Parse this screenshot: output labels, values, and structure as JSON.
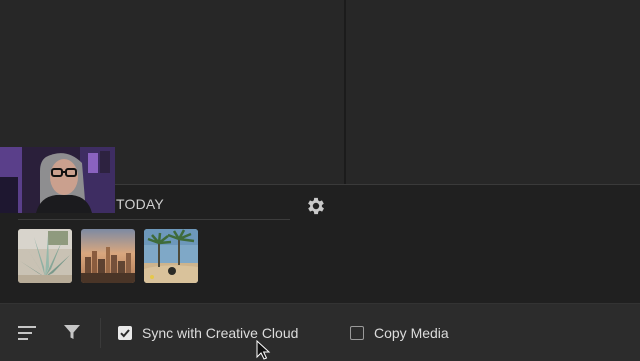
{
  "import_panel": {
    "section_title": "TODAY",
    "settings_icon": "gear-icon",
    "thumbnails": [
      {
        "name": "agave-plant-photo",
        "alt": "Agave plant"
      },
      {
        "name": "city-skyline-photo",
        "alt": "City skyline at dusk"
      },
      {
        "name": "desert-palm-photo",
        "alt": "Desert palm trees"
      }
    ]
  },
  "bottom_bar": {
    "sort_icon": "sort-lines-icon",
    "filter_icon": "filter-funnel-icon",
    "sync_label": "Sync with Creative Cloud",
    "sync_checked": true,
    "copy_label": "Copy Media",
    "copy_checked": false
  },
  "overlay": {
    "webcam": "presenter-webcam"
  },
  "colors": {
    "background": "#262626",
    "panel": "#202020",
    "bottom_bar": "#2c2c2c",
    "text": "#dcdcdc",
    "checkbox_on": "#e9e9e9"
  }
}
